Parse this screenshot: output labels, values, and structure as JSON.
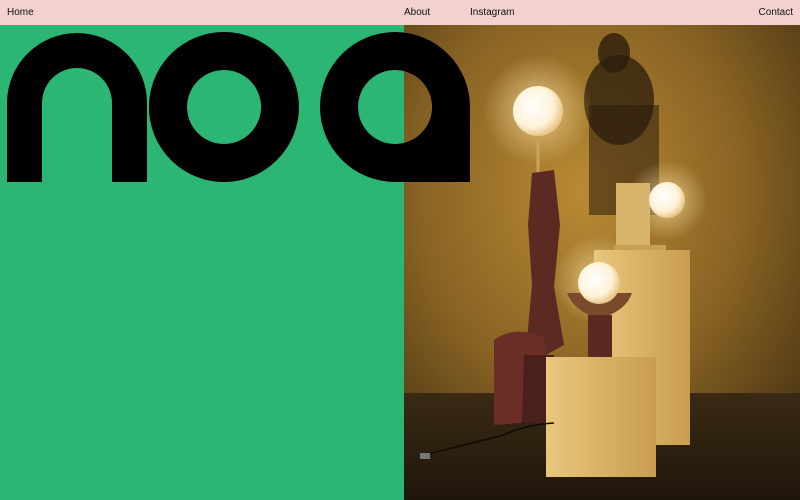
{
  "nav": {
    "home": "Home",
    "about": "About",
    "instagram": "Instagram",
    "contact": "Contact"
  },
  "brand": {
    "logo_text": "noa",
    "accent_green": "#2bb673",
    "topbar_pink": "#f1d2d0",
    "logo_black": "#000000"
  },
  "hero": {
    "image_description_icon": "gallery-photo"
  }
}
